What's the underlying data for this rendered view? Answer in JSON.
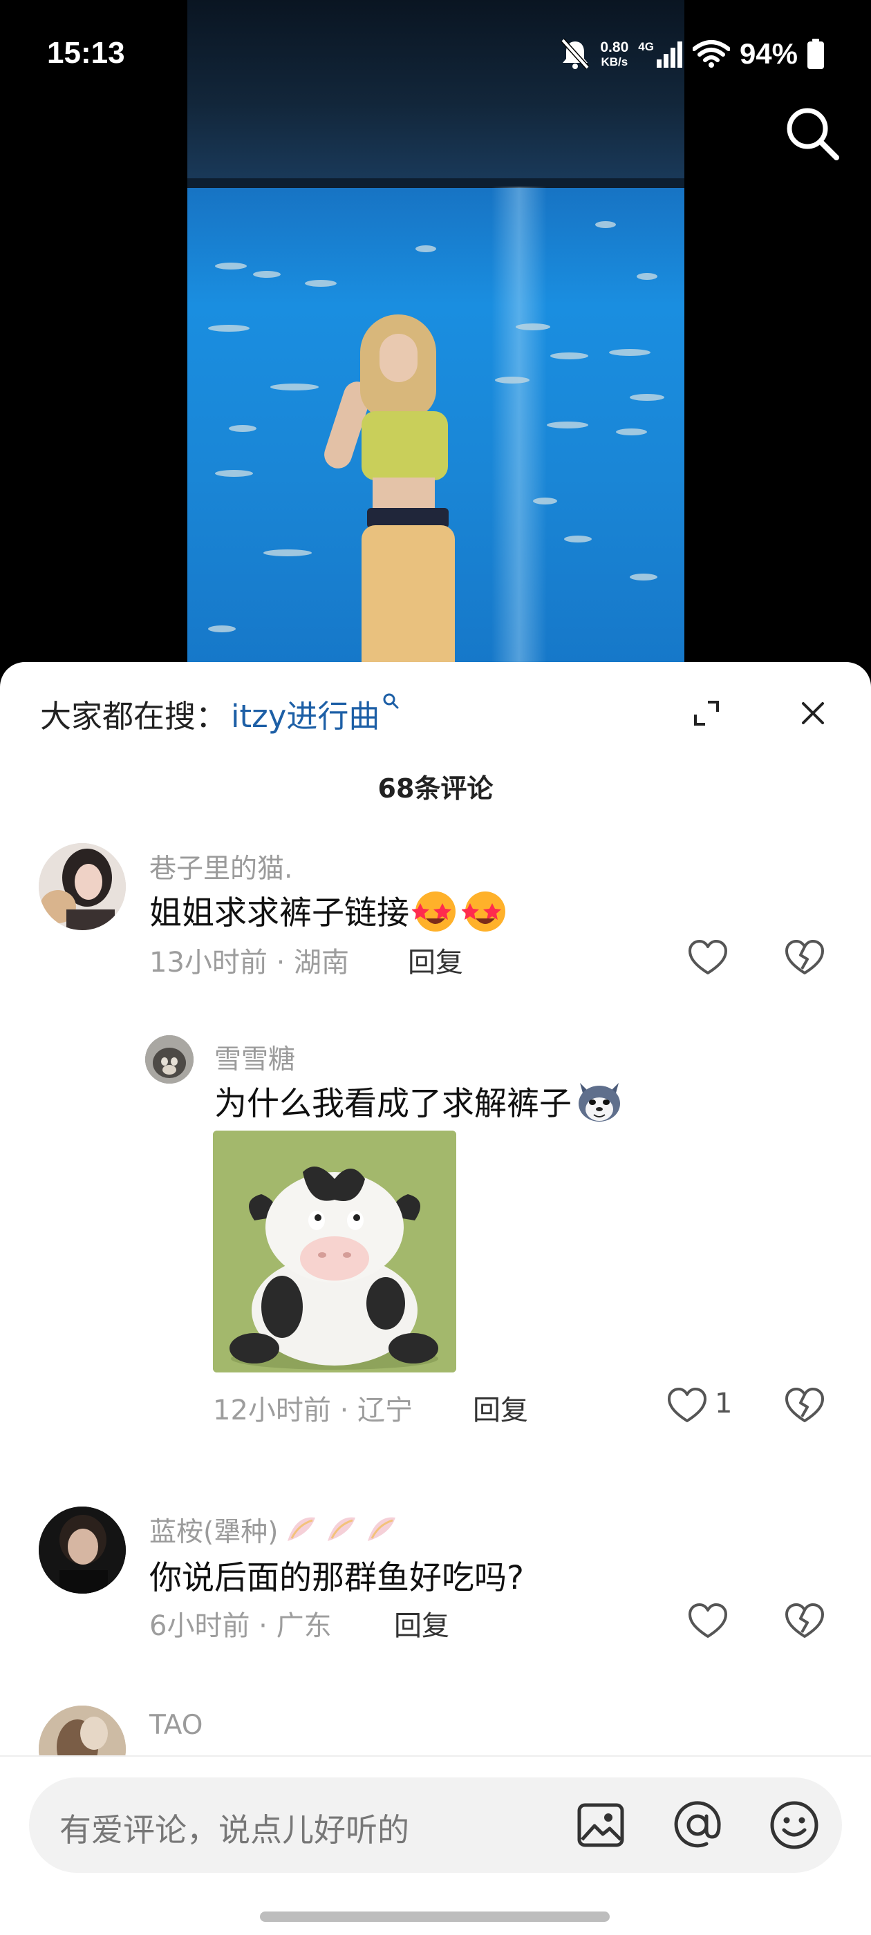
{
  "status_bar": {
    "time": "15:13",
    "net_speed_value": "0.80",
    "net_speed_unit": "KB/s",
    "network_type": "4G",
    "battery": "94%",
    "icons": [
      "mute-bell-icon",
      "signal-icon",
      "wifi-icon",
      "battery-icon"
    ]
  },
  "video": {
    "search_icon": "search-icon"
  },
  "sheet": {
    "hot_search_prefix": "大家都在搜：",
    "hot_search_keyword": "itzy进行曲",
    "comment_count": "68条评论",
    "icons": [
      "expand-icon",
      "close-icon"
    ]
  },
  "comments": [
    {
      "username": "巷子里的猫.",
      "text": "姐姐求求裤子链接",
      "emoji": [
        "star-struck",
        "star-struck"
      ],
      "time_location": "13小时前 · 湖南",
      "reply_label": "回复",
      "likes": ""
    },
    {
      "username": "雪雪糖",
      "text": "为什么我看成了求解裤子",
      "emoji": [
        "husky-face"
      ],
      "has_sticker": true,
      "time_location": "12小时前 · 辽宁",
      "reply_label": "回复",
      "likes": "1"
    },
    {
      "username": "蓝桉(犟种)",
      "text": "你说后面的那群鱼好吃吗?",
      "time_location": "6小时前 · 广东",
      "reply_label": "回复",
      "likes": ""
    },
    {
      "username": "TAO"
    }
  ],
  "input_bar": {
    "placeholder": "有爱评论，说点儿好听的",
    "icons": [
      "image-icon",
      "at-icon",
      "emoji-icon"
    ]
  }
}
